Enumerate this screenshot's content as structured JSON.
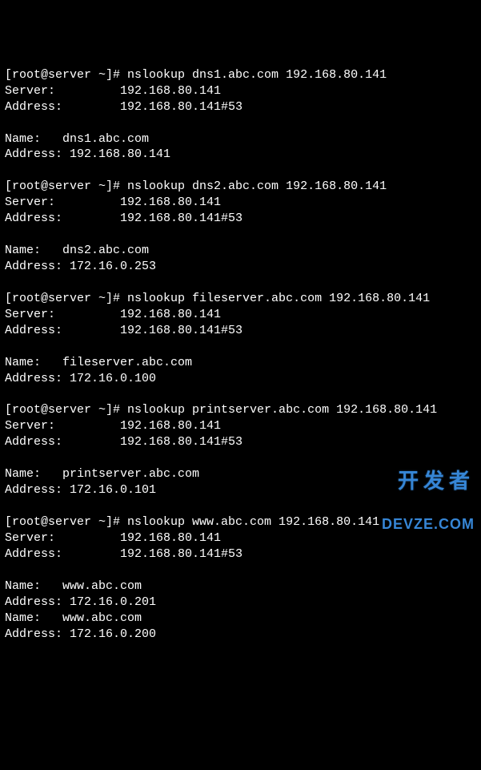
{
  "queries": [
    {
      "prompt": "[root@server ~]# ",
      "command": "nslookup dns1.abc.com 192.168.80.141",
      "server_label": "Server:         ",
      "server_value": "192.168.80.141",
      "address_label": "Address:        ",
      "address_value": "192.168.80.141#53",
      "results": [
        {
          "name_label": "Name:   ",
          "name_value": "dns1.abc.com",
          "addr_label": "Address: ",
          "addr_value": "192.168.80.141"
        }
      ]
    },
    {
      "prompt": "[root@server ~]# ",
      "command": "nslookup dns2.abc.com 192.168.80.141",
      "server_label": "Server:         ",
      "server_value": "192.168.80.141",
      "address_label": "Address:        ",
      "address_value": "192.168.80.141#53",
      "results": [
        {
          "name_label": "Name:   ",
          "name_value": "dns2.abc.com",
          "addr_label": "Address: ",
          "addr_value": "172.16.0.253"
        }
      ]
    },
    {
      "prompt": "[root@server ~]# ",
      "command": "nslookup fileserver.abc.com 192.168.80.141",
      "server_label": "Server:         ",
      "server_value": "192.168.80.141",
      "address_label": "Address:        ",
      "address_value": "192.168.80.141#53",
      "results": [
        {
          "name_label": "Name:   ",
          "name_value": "fileserver.abc.com",
          "addr_label": "Address: ",
          "addr_value": "172.16.0.100"
        }
      ]
    },
    {
      "prompt": "[root@server ~]# ",
      "command": "nslookup printserver.abc.com 192.168.80.141",
      "server_label": "Server:         ",
      "server_value": "192.168.80.141",
      "address_label": "Address:        ",
      "address_value": "192.168.80.141#53",
      "results": [
        {
          "name_label": "Name:   ",
          "name_value": "printserver.abc.com",
          "addr_label": "Address: ",
          "addr_value": "172.16.0.101"
        }
      ]
    },
    {
      "prompt": "[root@server ~]# ",
      "command": "nslookup www.abc.com 192.168.80.141",
      "server_label": "Server:         ",
      "server_value": "192.168.80.141",
      "address_label": "Address:        ",
      "address_value": "192.168.80.141#53",
      "results": [
        {
          "name_label": "Name:   ",
          "name_value": "www.abc.com",
          "addr_label": "Address: ",
          "addr_value": "172.16.0.201"
        },
        {
          "name_label": "Name:   ",
          "name_value": "www.abc.com",
          "addr_label": "Address: ",
          "addr_value": "172.16.0.200"
        }
      ]
    }
  ],
  "watermark": {
    "cn": "开发者",
    "en": "DEVZE.COM"
  }
}
